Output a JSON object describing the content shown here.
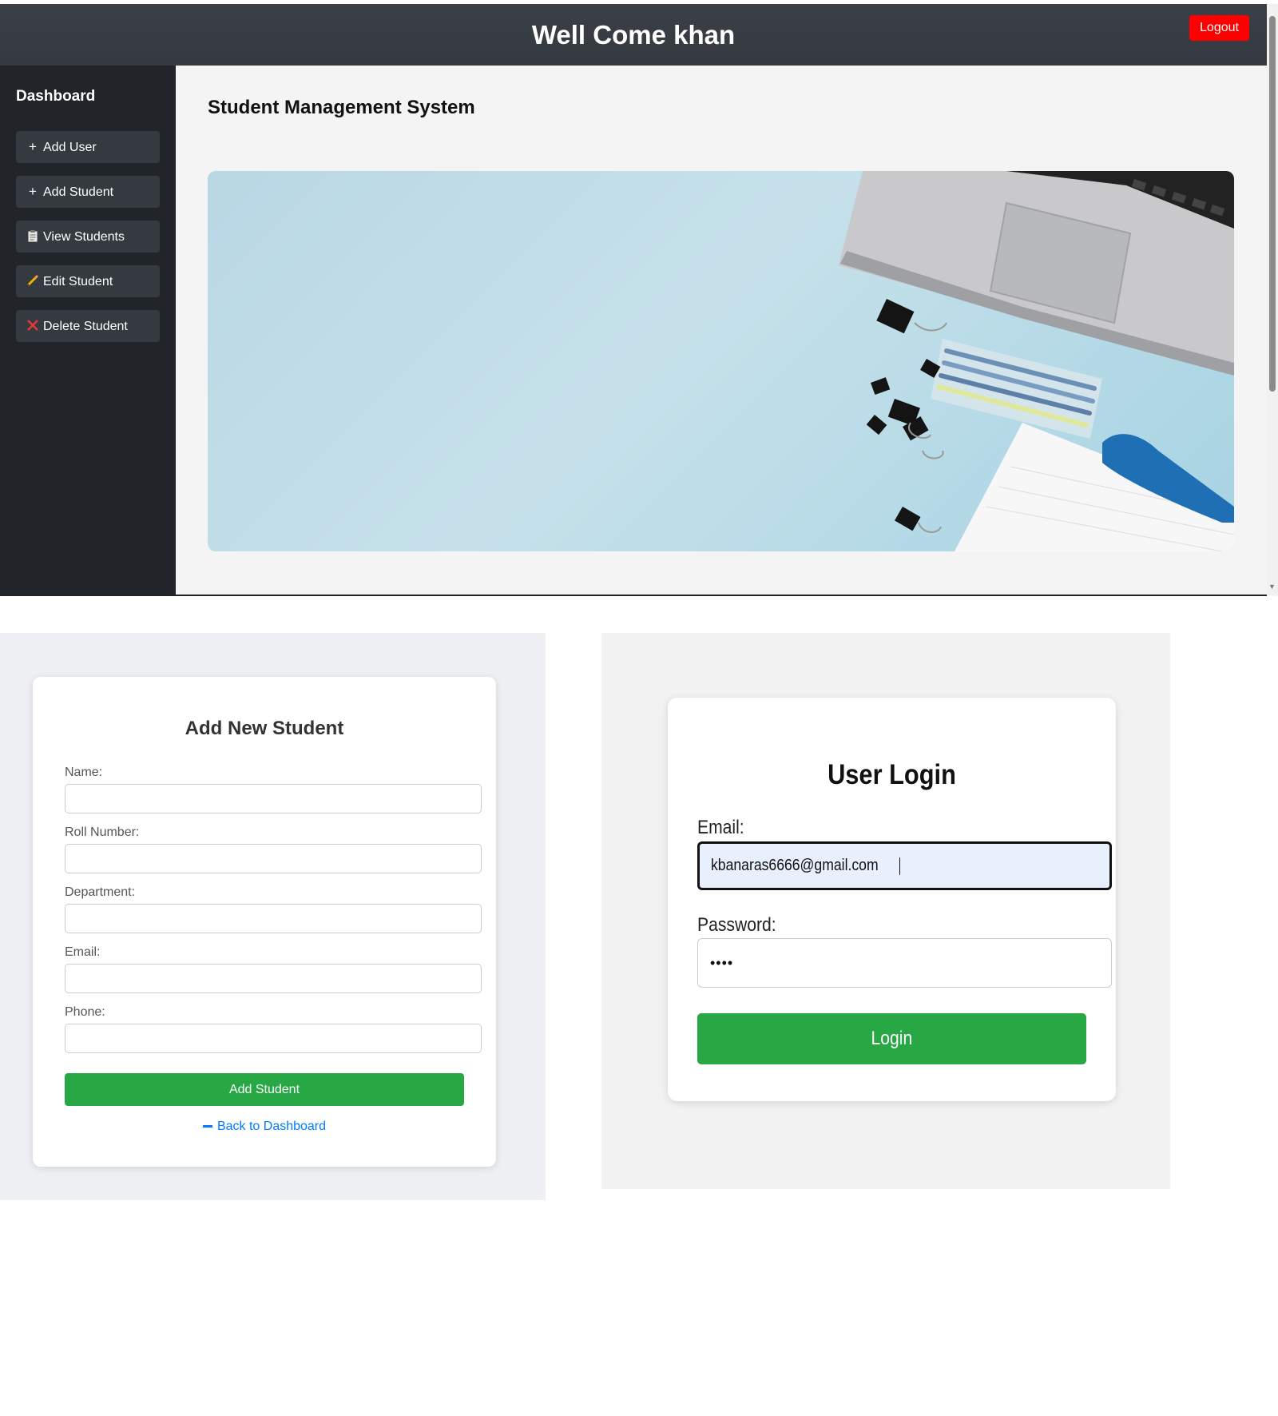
{
  "dashboard": {
    "header_title": "Well Come khan",
    "logout_label": "Logout",
    "sidebar": {
      "title": "Dashboard",
      "items": [
        {
          "icon": "plus-icon",
          "label": "Add User"
        },
        {
          "icon": "plus-icon",
          "label": "Add Student"
        },
        {
          "icon": "clipboard-icon",
          "label": "View Students"
        },
        {
          "icon": "pencil-icon",
          "label": "Edit Student"
        },
        {
          "icon": "cross-icon",
          "label": "Delete Student"
        }
      ]
    },
    "main_title": "Student Management System",
    "hero_image": "desk-laptop-binder-clips-image"
  },
  "add_student": {
    "title": "Add New Student",
    "fields": [
      {
        "label": "Name:",
        "value": ""
      },
      {
        "label": "Roll Number:",
        "value": ""
      },
      {
        "label": "Department:",
        "value": ""
      },
      {
        "label": "Email:",
        "value": ""
      },
      {
        "label": "Phone:",
        "value": ""
      }
    ],
    "submit_label": "Add Student",
    "back_link": "Back to Dashboard"
  },
  "login": {
    "title": "User Login",
    "email_label": "Email:",
    "email_value": "kbanaras6666@gmail.com",
    "password_label": "Password:",
    "password_value": "••••",
    "submit_label": "Login"
  },
  "colors": {
    "header_bg": "#343a40",
    "sidebar_bg": "#212529",
    "logout_bg": "#ff0000",
    "success_green": "#28a745",
    "link_blue": "#007bff"
  }
}
